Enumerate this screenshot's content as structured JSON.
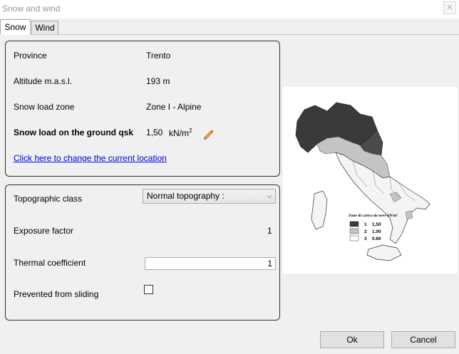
{
  "window": {
    "title": "Snow and wind",
    "close_glyph": "✕"
  },
  "tabs": [
    {
      "label": "Snow",
      "active": true
    },
    {
      "label": "Wind",
      "active": false
    }
  ],
  "location": {
    "province_label": "Province",
    "province_value": "Trento",
    "altitude_label": "Altitude m.a.s.l.",
    "altitude_value": "193 m",
    "zone_label": "Snow load zone",
    "zone_value": "Zone I - Alpine",
    "qsk_label": "Snow load on the ground qsk",
    "qsk_value": "1,50",
    "qsk_unit": "kN/m",
    "qsk_unit_exp": "2",
    "change_link": "Click here to change the current location",
    "edit_icon": "pencil-icon"
  },
  "coefficients": {
    "topographic_label": "Topographic class",
    "topographic_value": "Normal topography :",
    "exposure_label": "Exposure factor",
    "exposure_value": "1",
    "thermal_label": "Thermal coefficient",
    "thermal_value": "1",
    "sliding_label": "Prevented from sliding",
    "sliding_checked": false
  },
  "map": {
    "legend_title": "Zone di carico da neve kN/m²",
    "legend": [
      {
        "zone": "1",
        "value": "1,50"
      },
      {
        "zone": "2",
        "value": "1.00"
      },
      {
        "zone": "3",
        "value": "0.60"
      }
    ]
  },
  "buttons": {
    "ok": "Ok",
    "cancel": "Cancel"
  },
  "colors": {
    "link": "#0000cc",
    "panel_border": "#303030",
    "title_text": "#999999"
  }
}
